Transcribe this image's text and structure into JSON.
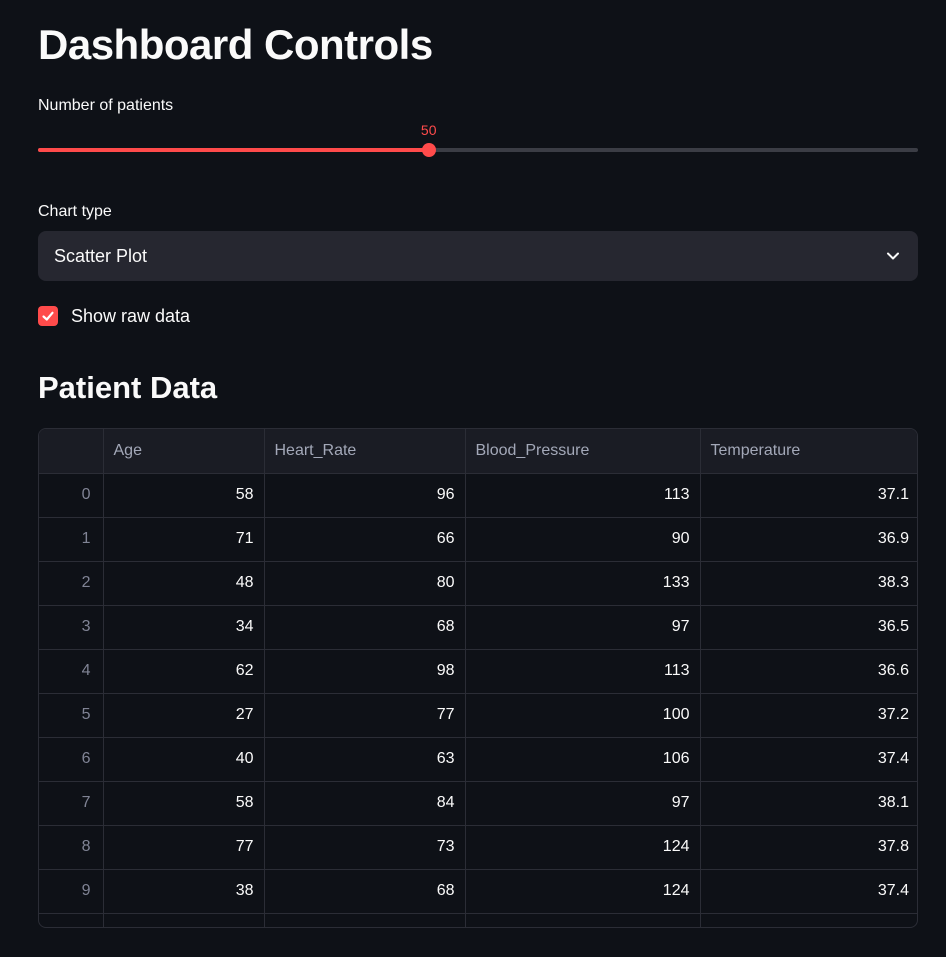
{
  "header": {
    "title": "Dashboard Controls"
  },
  "slider": {
    "label": "Number of patients",
    "value": "50",
    "fraction": 0.444
  },
  "chart_type": {
    "label": "Chart type",
    "selected": "Scatter Plot",
    "icon": "chevron-down-icon"
  },
  "raw_data_toggle": {
    "label": "Show raw data",
    "checked": true,
    "icon": "checkmark-icon"
  },
  "section": {
    "title": "Patient Data"
  },
  "table": {
    "columns": [
      "",
      "Age",
      "Heart_Rate",
      "Blood_Pressure",
      "Temperature"
    ],
    "rows": [
      [
        "0",
        "58",
        "96",
        "113",
        "37.1"
      ],
      [
        "1",
        "71",
        "66",
        "90",
        "36.9"
      ],
      [
        "2",
        "48",
        "80",
        "133",
        "38.3"
      ],
      [
        "3",
        "34",
        "68",
        "97",
        "36.5"
      ],
      [
        "4",
        "62",
        "98",
        "113",
        "36.6"
      ],
      [
        "5",
        "27",
        "77",
        "100",
        "37.2"
      ],
      [
        "6",
        "40",
        "63",
        "106",
        "37.4"
      ],
      [
        "7",
        "58",
        "84",
        "97",
        "38.1"
      ],
      [
        "8",
        "77",
        "73",
        "124",
        "37.8"
      ],
      [
        "9",
        "38",
        "68",
        "124",
        "37.4"
      ]
    ]
  },
  "colors": {
    "accent": "#ff4b4b",
    "background": "#0e1117",
    "widget": "#262730"
  }
}
